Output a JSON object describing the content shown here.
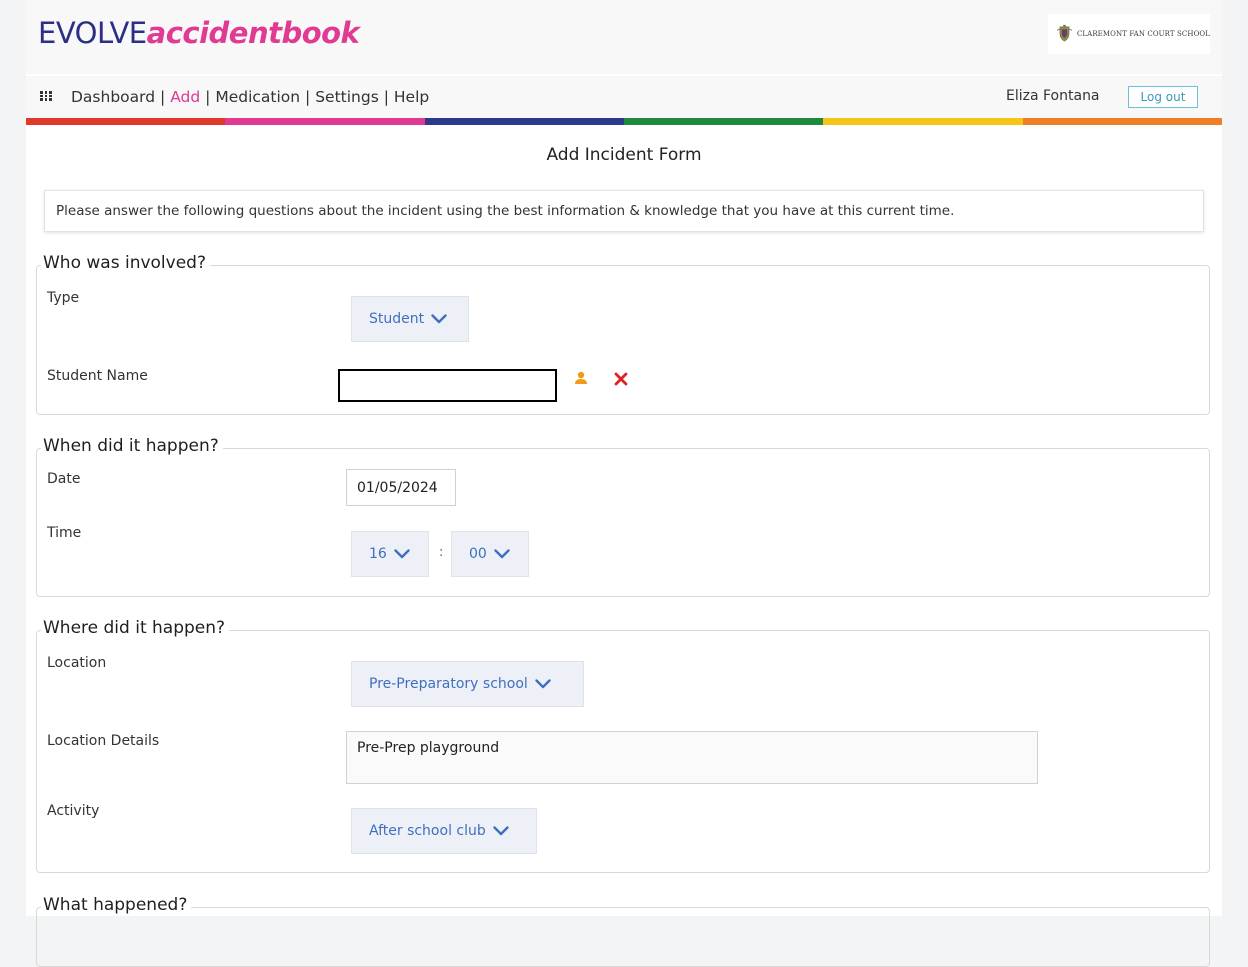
{
  "header": {
    "logo_part1": "EVOLVE",
    "logo_part2": "accidentbook",
    "school_name": "CLAREMONT FAN COURT SCHOOL"
  },
  "nav": {
    "items": [
      "Dashboard",
      "Add",
      "Medication",
      "Settings",
      "Help"
    ],
    "separator": "|",
    "active": "Add",
    "user_name": "Eliza Fontana",
    "logout_label": "Log out"
  },
  "colors": {
    "brand_navy": "#2b2f86",
    "brand_pink": "#e03a92",
    "rainbow": [
      "#e0392b",
      "#e03a92",
      "#2b3a8c",
      "#1e8a3e",
      "#f5c518",
      "#f07d28"
    ],
    "select_text": "#3f6fc0",
    "remove_icon": "#e02020",
    "person_icon": "#f29a16"
  },
  "form": {
    "title": "Add Incident Form",
    "intro": "Please answer the following questions about the incident using the best information & knowledge that you have at this current time."
  },
  "sections": {
    "who": {
      "legend": "Who was involved?",
      "type_label": "Type",
      "type_value": "Student",
      "student_name_label": "Student Name",
      "student_name_value": ""
    },
    "when": {
      "legend": "When did it happen?",
      "date_label": "Date",
      "date_value": "01/05/2024",
      "time_label": "Time",
      "time_hour": "16",
      "time_separator": ":",
      "time_minute": "00"
    },
    "where": {
      "legend": "Where did it happen?",
      "location_label": "Location",
      "location_value": "Pre-Preparatory school",
      "location_details_label": "Location Details",
      "location_details_value": "Pre-Prep playground",
      "activity_label": "Activity",
      "activity_value": "After school club"
    },
    "what": {
      "legend": "What happened?"
    }
  }
}
